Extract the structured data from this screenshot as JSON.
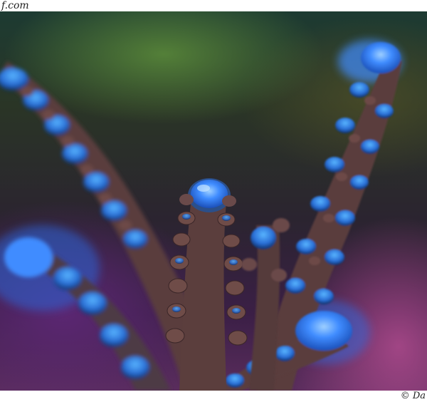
{
  "watermark": {
    "top_text": "f.com",
    "bottom_text": "© Da"
  },
  "colors": {
    "coral_glow": "#3f8cff",
    "coral_stalk": "#5a3d3c",
    "background_green": "#5c8c3a",
    "background_purple": "#5f2878",
    "background_pink": "#be5096"
  }
}
